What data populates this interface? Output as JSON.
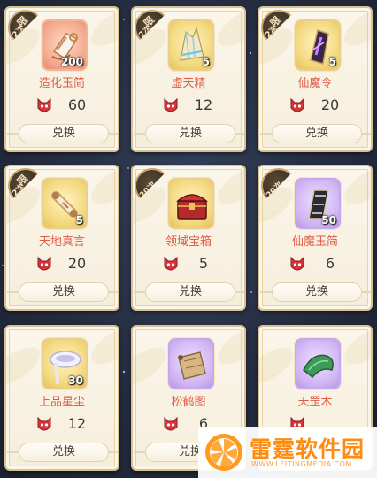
{
  "colors": {
    "background": "#232b3e",
    "card": "#f8f1e2",
    "item_name": "#e05a48",
    "watermark_orange": "#ff8c12"
  },
  "currency_icon": "demon-mask-icon",
  "items": [
    {
      "name": "造化玉简",
      "count": "200",
      "price": "60",
      "limit_top": "限",
      "limit_bottom": "2次",
      "frame": "red",
      "icon": "jade-scroll-icon"
    },
    {
      "name": "虚天精",
      "count": "5",
      "price": "12",
      "limit_top": "限",
      "limit_bottom": "2次",
      "frame": "gold",
      "icon": "crystal-shard-icon"
    },
    {
      "name": "仙魔令",
      "count": "5",
      "price": "20",
      "limit_top": "限",
      "limit_bottom": "2次",
      "frame": "gold",
      "icon": "purple-token-icon"
    },
    {
      "name": "天地真言",
      "count": "5",
      "price": "20",
      "limit_top": "限",
      "limit_bottom": "2次",
      "frame": "gold",
      "icon": "rolled-scroll-icon"
    },
    {
      "name": "领域宝箱",
      "count": "",
      "price": "5",
      "limit_top": "",
      "limit_bottom": "20次",
      "frame": "gold",
      "icon": "treasure-chest-icon"
    },
    {
      "name": "仙魔玉简",
      "count": "50",
      "price": "6",
      "limit_top": "",
      "limit_bottom": "20次",
      "frame": "purple",
      "icon": "dark-jade-scroll-icon"
    },
    {
      "name": "上品星尘",
      "count": "30",
      "price": "12",
      "limit_top": "",
      "limit_bottom": "",
      "frame": "gold",
      "icon": "star-dust-icon"
    },
    {
      "name": "松鹤图",
      "count": "",
      "price": "6",
      "limit_top": "",
      "limit_bottom": "",
      "frame": "purple",
      "icon": "painting-scroll-icon"
    },
    {
      "name": "天罡木",
      "count": "",
      "price": "",
      "limit_top": "",
      "limit_bottom": "",
      "frame": "purple",
      "icon": "green-wood-icon"
    }
  ],
  "exchange_label": "兑换",
  "watermark": {
    "title": "雷霆软件园",
    "url": "WWW.LEITINGMEDIA.COM"
  }
}
